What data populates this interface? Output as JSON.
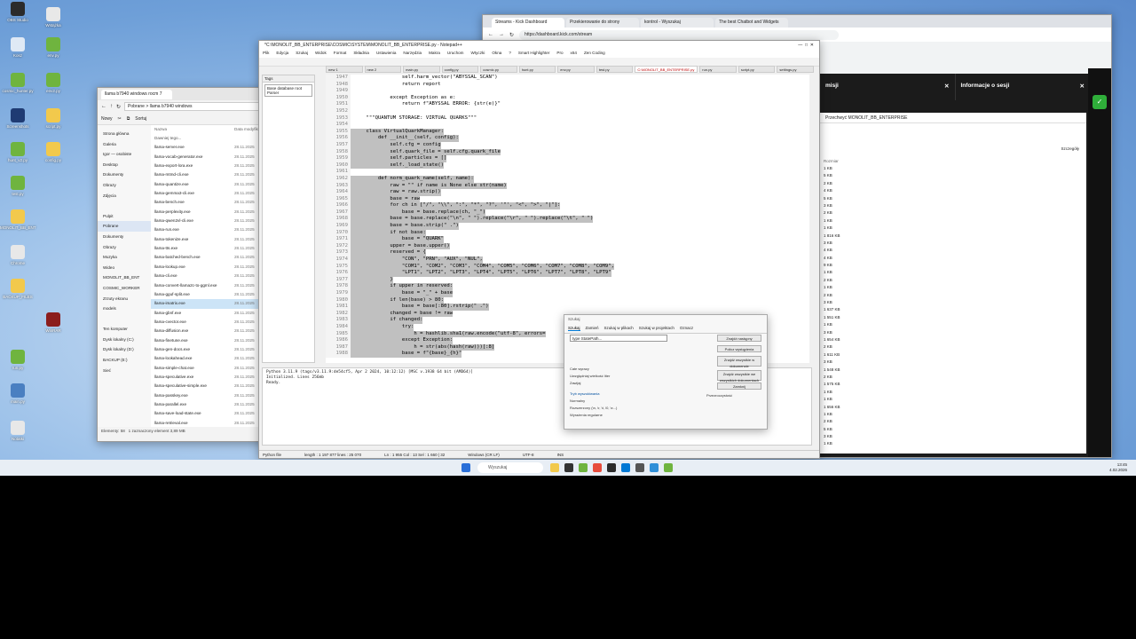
{
  "desktop": {
    "icons": [
      {
        "label": "OBS Studio",
        "color": "#2b2b2b"
      },
      {
        "label": "Wstążka",
        "color": "#e8e8e8"
      },
      {
        "label": "Kosz",
        "color": "#dfe9f5"
      },
      {
        "label": "env.py",
        "color": "#6fb43f"
      },
      {
        "label": "cosmic_hunter.py",
        "color": "#6fb43f"
      },
      {
        "label": "env2.py",
        "color": "#6fb43f"
      },
      {
        "label": "Screenshots",
        "color": "#1f3b73"
      },
      {
        "label": "script.py",
        "color": "#f2c94c"
      },
      {
        "label": "hunt_v2.py",
        "color": "#6fb43f"
      },
      {
        "label": "config.py",
        "color": "#f2c94c"
      },
      {
        "label": "test.py",
        "color": "#6fb43f"
      },
      {
        "label": "MONOLIT_BB_ENT",
        "color": "#f2c94c"
      },
      {
        "label": "Chrome",
        "color": "#e8e8e8"
      },
      {
        "label": "BACKUP_FILES",
        "color": "#f2c94c"
      },
      {
        "label": "WinRAR",
        "color": "#8b1d1d"
      },
      {
        "label": "run.py",
        "color": "#6fb43f"
      },
      {
        "label": "main.py",
        "color": "#4a7fc1"
      },
      {
        "label": "Notatki",
        "color": "#e8e8e8"
      }
    ]
  },
  "explorer": {
    "tab_title": "llama b7940 windows rocm 7",
    "address": "Pobrane  >  llama b7940 windows",
    "toolbar": {
      "new": "Nowy",
      "sort": "Sortuj",
      "view": "Widok"
    },
    "nav_items": [
      "Strona główna",
      "Galeria",
      "Igor — osobiste",
      "Desktop",
      "Dokumenty",
      "Obrazy",
      "Zdjęcia",
      "",
      "Pulpit",
      "Pobrane",
      "Dokumenty",
      "Obrazy",
      "Muzyka",
      "Wideo",
      "MONOLIT_BB_ENT",
      "COSMIC_WORKER",
      "Zrzuty ekranu",
      "models",
      "",
      "Ten komputer",
      "Dysk lokalny (C:)",
      "Dysk lokalny (D:)",
      "BACKUP (E:)",
      "Sieć"
    ],
    "nav_selected": 9,
    "columns": {
      "name": "Nazwa",
      "date": "Data modyfikacji"
    },
    "group_label": "Dawniej tego...",
    "files": [
      "llama-server.exe",
      "llama-vocab-generator.exe",
      "llama-export-lora.exe",
      "llama-mtmd-cli.exe",
      "llama-quantize.exe",
      "llama-gemma3-cli.exe",
      "llama-bench.exe",
      "llama-perplexity.exe",
      "llama-qwen2vl-cli.exe",
      "llama-run.exe",
      "llama-tokenize.exe",
      "llama-tts.exe",
      "llama-batched-bench.exe",
      "llama-lookup.exe",
      "llama-cli.exe",
      "llama-convert-llama2c-to-ggml.exe",
      "llama-gguf-split.exe",
      "llama-imatrix.exe",
      "llama-gbnf.exe",
      "llama-cvector.exe",
      "llama-diffusion.exe",
      "llama-finetune.exe",
      "llama-gen-docs.exe",
      "llama-lookahead.exe",
      "llama-simple-chat.exe",
      "llama-speculative.exe",
      "llama-speculative-simple.exe",
      "llama-passkey.exe",
      "llama-parallel.exe",
      "llama-save-load-state.exe",
      "llama-retrieval.exe"
    ],
    "file_date": "28.11.2025",
    "selected_file": 17,
    "status_count": "Elementy: 58",
    "status_sel": "1 zaznaczony element  3,89 MB"
  },
  "browser": {
    "tabs": [
      "Streams - Kick Dashboard",
      "Przekierowanie do strony",
      "kontrol - Wyszukaj",
      "The best Chatbot and Widgets"
    ],
    "active_tab": 0,
    "url": "https://dashboard.kick.com/stream",
    "panel_left": "misji",
    "panel_right": "Informacje o sesji",
    "find_placeholder": "Przechwyć MONOLIT_BB_ENTERPRISE",
    "right_label": "Szczegóły",
    "sizes": [
      "1 KB",
      "5 KB",
      "2 KB",
      "4 KB",
      "5 KB",
      "3 KB",
      "2 KB",
      "1 KB",
      "1 KB",
      "1 816 KB",
      "3 KB",
      "4 KB",
      "4 KB",
      "9 KB",
      "1 KB",
      "2 KB",
      "1 KB",
      "2 KB",
      "3 KB",
      "1 637 KB",
      "1 551 KB",
      "1 KB",
      "3 KB",
      "1 654 KB",
      "2 KB",
      "1 611 KB",
      "3 KB",
      "1 548 KB",
      "2 KB",
      "1 575 KB",
      "1 KB",
      "1 KB",
      "1 656 KB",
      "1 KB",
      "2 KB",
      "5 KB",
      "3 KB",
      "1 KB"
    ],
    "size_header": "Rozmiar"
  },
  "npp": {
    "title": "*C:\\MONOLIT_BB_ENTERPRISE\\COSMIC\\SYSTEM\\MONOLIT_BB_ENTERPRISE.py - Notepad++",
    "menu": [
      "Plik",
      "Edycja",
      "Szukaj",
      "Widok",
      "Format",
      "Składnia",
      "Ustawienia",
      "Narzędzia",
      "Makra",
      "Uruchom",
      "Wtyczki",
      "Okna",
      "?",
      "Smart Highlighter",
      "Pro",
      "x64",
      "Zen Coding"
    ],
    "tabs": [
      "new 1",
      "new 2",
      "main.py",
      "config.py",
      "cosmic.py",
      "hunt.py",
      "env.py",
      "test.py",
      "C:\\MONOLIT_BB_ENTERPRISE.py",
      "run.py",
      "script.py",
      "settings.py"
    ],
    "active_tab": 8,
    "left_panel_title": "Tags",
    "left_panel_item": "Base database root Parser",
    "code": [
      {
        "n": "1947",
        "t": "                self.harm_vector(\"ABYSSAL_SCAN\")",
        "hl": false
      },
      {
        "n": "1948",
        "t": "                return report",
        "hl": false
      },
      {
        "n": "1949",
        "t": "",
        "hl": false
      },
      {
        "n": "1950",
        "t": "            except Exception as e:",
        "hl": false
      },
      {
        "n": "1951",
        "t": "                return f\"ABYSSAL ERROR: {str(e)}\"",
        "hl": false
      },
      {
        "n": "1952",
        "t": "",
        "hl": false
      },
      {
        "n": "1953",
        "t": "    \"\"\"QUANTUM STORAGE: VIRTUAL QUARKS\"\"\"",
        "hl": false
      },
      {
        "n": "1954",
        "t": "",
        "hl": false
      },
      {
        "n": "1955",
        "t": "    class VirtualQuarkManager:",
        "hl": true
      },
      {
        "n": "1956",
        "t": "        def __init__(self, config):",
        "hl": true
      },
      {
        "n": "1957",
        "t": "            self.cfg = config",
        "hl": true
      },
      {
        "n": "1958",
        "t": "            self.quark_file = self.cfg.quark_file",
        "hl": true
      },
      {
        "n": "1959",
        "t": "            self.particles = []",
        "hl": true
      },
      {
        "n": "1960",
        "t": "            self._load_state()",
        "hl": true
      },
      {
        "n": "1961",
        "t": "",
        "hl": false
      },
      {
        "n": "1962",
        "t": "        def norm_quark_name(self, name):",
        "hl": true
      },
      {
        "n": "1963",
        "t": "            raw = \"\" if name is None else str(name)",
        "hl": true
      },
      {
        "n": "1964",
        "t": "            raw = raw.strip()",
        "hl": true
      },
      {
        "n": "1965",
        "t": "            base = raw",
        "hl": true
      },
      {
        "n": "1966",
        "t": "            for ch in [\"/\", \"\\\\\", \":\", \"*\", \"?\", '\"', \"<\", \">\", \"|\"]:",
        "hl": true
      },
      {
        "n": "1967",
        "t": "                base = base.replace(ch, \"_\")",
        "hl": true
      },
      {
        "n": "1968",
        "t": "            base = base.replace(\"\\n\", \" \").replace(\"\\r\", \" \").replace(\"\\t\", \" \")",
        "hl": true
      },
      {
        "n": "1969",
        "t": "            base = base.strip(\" .\")",
        "hl": true
      },
      {
        "n": "1970",
        "t": "            if not base:",
        "hl": true
      },
      {
        "n": "1971",
        "t": "                base = \"QUARK\"",
        "hl": true
      },
      {
        "n": "1972",
        "t": "            upper = base.upper()",
        "hl": true
      },
      {
        "n": "1973",
        "t": "            reserved = {",
        "hl": true
      },
      {
        "n": "1974",
        "t": "                \"CON\", \"PRN\", \"AUX\", \"NUL\",",
        "hl": true
      },
      {
        "n": "1975",
        "t": "                \"COM1\", \"COM2\", \"COM3\", \"COM4\", \"COM5\", \"COM6\", \"COM7\", \"COM8\", \"COM9\",",
        "hl": true
      },
      {
        "n": "1976",
        "t": "                \"LPT1\", \"LPT2\", \"LPT3\", \"LPT4\", \"LPT5\", \"LPT6\", \"LPT7\", \"LPT8\", \"LPT9\"",
        "hl": true
      },
      {
        "n": "1977",
        "t": "            }",
        "hl": true
      },
      {
        "n": "1978",
        "t": "            if upper in reserved:",
        "hl": true
      },
      {
        "n": "1979",
        "t": "                base = \"_\" + base",
        "hl": true
      },
      {
        "n": "1980",
        "t": "            if len(base) > 80:",
        "hl": true
      },
      {
        "n": "1981",
        "t": "                base = base[:80].rstrip(\" .\")",
        "hl": true
      },
      {
        "n": "1982",
        "t": "            changed = base != raw",
        "hl": true
      },
      {
        "n": "1983",
        "t": "            if changed:",
        "hl": true
      },
      {
        "n": "1984",
        "t": "                try:",
        "hl": true
      },
      {
        "n": "1985",
        "t": "                    h = hashlib.sha1(raw.encode(\"utf-8\", errors=",
        "hl": true
      },
      {
        "n": "1986",
        "t": "                except Exception:",
        "hl": true
      },
      {
        "n": "1987",
        "t": "                    h = str(abs(hash(raw)))[:8]",
        "hl": true
      },
      {
        "n": "1988",
        "t": "                base = f\"{base}_{h}\"",
        "hl": true
      }
    ],
    "console": [
      "Python 3.11.9 (tags/v3.11.9:de54cf5, Apr  2 2024, 10:12:12) [MSC v.1938 64 bit (AMD64)]",
      "Initialized. Lines 256mb",
      "Ready."
    ],
    "console_title": "Python",
    "status": [
      "Python file",
      "length : 1 197 877    lines : 25 070",
      "Ln : 1 955    Col : 13    Sel : 1 660 | 32",
      "Windows (CR LF)",
      "UTF-8",
      "INS"
    ]
  },
  "find": {
    "title": "Szukaj",
    "tabs": [
      "Szukaj",
      "Zamień",
      "Szukaj w plikach",
      "Szukaj w projektach",
      "Oznacz"
    ],
    "find_label": "Szukany tekst :",
    "find_value": "type StatePath...",
    "buttons": [
      "Znajdź następny",
      "Policz wystąpienia",
      "Znajdź wszystkie w dokumencie",
      "Znajdź wszystkie we wszystkich dokumentach",
      "Zamknij"
    ],
    "options": [
      "Całe wyrazy",
      "Uwzględniaj wielkość liter",
      "Zawijaj",
      "Tryb wyszukiwania",
      "Normalny",
      "Rozszerzony (\\n, \\r, \\t, \\0, \\x...)",
      "Wyrażenia regularne"
    ],
    "transparency": "Przezroczystość"
  },
  "taskbar": {
    "search": "Wyszukaj",
    "time": "13:45",
    "date": "4.02.2026"
  }
}
